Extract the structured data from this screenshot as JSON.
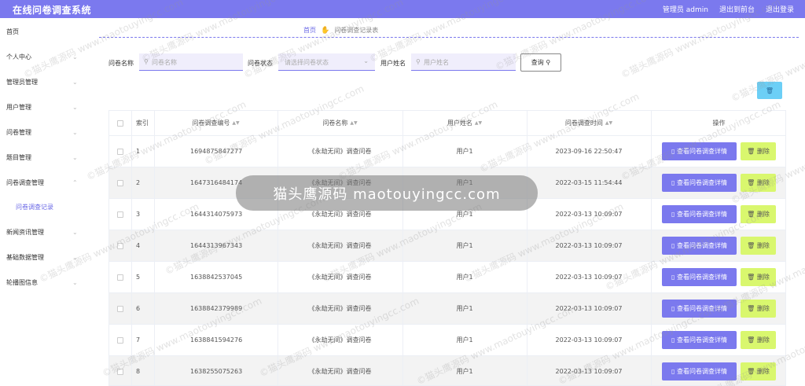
{
  "app": {
    "title": "在线问卷调查系统",
    "user_label": "管理员 admin",
    "back_label": "退出到前台",
    "logout_label": "退出登录"
  },
  "sidebar": {
    "items": [
      {
        "label": "首页",
        "has_children": false
      },
      {
        "label": "个人中心",
        "has_children": true
      },
      {
        "label": "管理员管理",
        "has_children": true
      },
      {
        "label": "用户管理",
        "has_children": true
      },
      {
        "label": "问卷管理",
        "has_children": true
      },
      {
        "label": "题目管理",
        "has_children": true
      },
      {
        "label": "问卷调查管理",
        "has_children": true,
        "expanded": true
      },
      {
        "label": "新闻资讯管理",
        "has_children": true
      },
      {
        "label": "基础数据管理",
        "has_children": true
      },
      {
        "label": "轮播图信息",
        "has_children": true
      }
    ],
    "sub_item": "问卷调查记录"
  },
  "breadcrumb": {
    "home": "首页",
    "current": "问卷调查记录表"
  },
  "filters": {
    "name_label": "问卷名称",
    "name_placeholder": "问卷名称",
    "status_label": "问卷状态",
    "status_placeholder": "请选择问卷状态",
    "user_label": "用户姓名",
    "user_placeholder": "用户姓名",
    "query_label": "查询"
  },
  "table": {
    "columns": [
      "索引",
      "问卷调查编号",
      "问卷名称",
      "用户姓名",
      "问卷调查时间",
      "操作"
    ],
    "view_label": "查看问卷调查详情",
    "delete_label": "删除",
    "rows": [
      {
        "index": "1",
        "code": "1694875847277",
        "name": "《永劫无间》调查问卷",
        "user": "用户1",
        "time": "2023-09-16 22:50:47"
      },
      {
        "index": "2",
        "code": "1647316484174",
        "name": "《永劫无间》调查问卷",
        "user": "用户1",
        "time": "2022-03-15 11:54:44"
      },
      {
        "index": "3",
        "code": "1644314075973",
        "name": "《永劫无间》调查问卷",
        "user": "用户1",
        "time": "2022-03-13 10:09:07"
      },
      {
        "index": "4",
        "code": "1644313967343",
        "name": "《永劫无间》调查问卷",
        "user": "用户1",
        "time": "2022-03-13 10:09:07"
      },
      {
        "index": "5",
        "code": "1638842537045",
        "name": "《永劫无间》调查问卷",
        "user": "用户1",
        "time": "2022-03-13 10:09:07"
      },
      {
        "index": "6",
        "code": "1638842379989",
        "name": "《永劫无间》调查问卷",
        "user": "用户1",
        "time": "2022-03-13 10:09:07"
      },
      {
        "index": "7",
        "code": "1638841594276",
        "name": "《永劫无间》调查问卷",
        "user": "用户1",
        "time": "2022-03-13 10:09:07"
      },
      {
        "index": "8",
        "code": "1638255075263",
        "name": "《永劫无间》调查问卷",
        "user": "用户1",
        "time": "2022-03-13 10:09:07"
      }
    ]
  },
  "overlay_text": "猫头鹰源码 maotouyingcc.com",
  "watermark_text": "©猫头鹰源码 www.maotouyingcc.com",
  "colors": {
    "accent": "#7b79ee",
    "delete_button": "#d9f76e",
    "bulk_delete": "#6ccff6"
  }
}
